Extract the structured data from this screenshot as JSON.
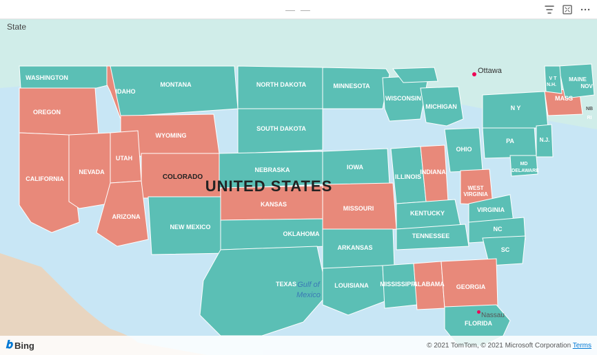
{
  "toolbar": {
    "drag_handle": "drag handle",
    "filter_icon": "▽",
    "expand_icon": "⤢",
    "more_icon": "⋯"
  },
  "map": {
    "title": "State",
    "center_label": "UNITED STATES",
    "gulf_label": "Gulf of\nMexico",
    "ottawa_label": "Ottawa",
    "nassau_label": "Nassau",
    "nb_label": "NB",
    "maine_label": "MAINE",
    "states": {
      "teal": [
        "WASHINGTON",
        "MONTANA",
        "NORTH DAKOTA",
        "MINNESOTA",
        "SOUTH DAKOTA",
        "NEBRASKA",
        "IOWA",
        "WISCONSIN",
        "MICHIGAN",
        "ILLINOIS",
        "INDIANA",
        "OHIO",
        "WEST VIRGINIA",
        "VIRGINIA",
        "NC",
        "TENNESSEE",
        "ARKANSAS",
        "TEXAS",
        "LOUISIANA",
        "MISSISSIPPI",
        "FLORIDA",
        "SC"
      ],
      "salmon": [
        "OREGON",
        "IDAHO",
        "WYOMING",
        "UTAH",
        "COLORADO",
        "NEVADA",
        "CALIFORNIA",
        "ARIZONA",
        "NEW MEXICO",
        "KANSAS",
        "MISSOURI",
        "KENTUCKY",
        "OKLAHOMA",
        "ALABAMA",
        "GEORGIA",
        "MASSACHUSETTS",
        "INDIANA"
      ]
    },
    "colors": {
      "teal": "#5bbfb5",
      "salmon": "#e8897a",
      "water": "#c8e6f5",
      "border": "#ffffff",
      "canada": "#d0ede9",
      "mexico": "#e8d5c0"
    }
  },
  "bottom_bar": {
    "bing_label": "Bing",
    "copyright": "© 2021 TomTom, © 2021 Microsoft Corporation",
    "terms": "Terms"
  }
}
